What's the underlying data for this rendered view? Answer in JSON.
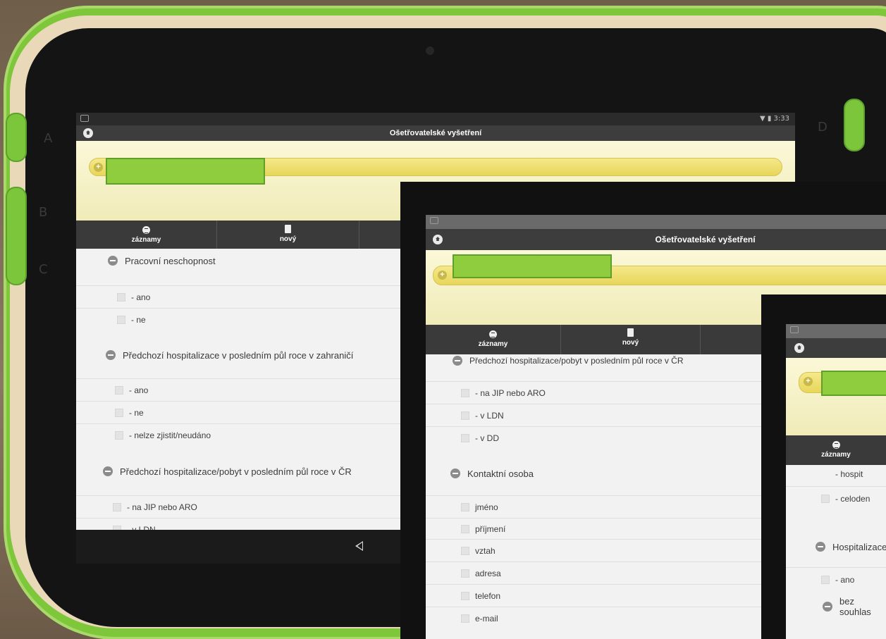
{
  "app": {
    "title": "Ošetřovatelské vyšetření",
    "status_time": "3:33"
  },
  "toolbar": {
    "records_label": "záznamy",
    "new_label": "nový"
  },
  "bezel": {
    "letters": [
      "A",
      "B",
      "C",
      "D"
    ]
  },
  "screen1": {
    "sections": [
      {
        "title": "Pracovní neschopnost",
        "options": [
          "- ano",
          "- ne"
        ]
      },
      {
        "title": "Předchozí hospitalizace v posledním půl roce v zahraničí",
        "options": [
          "- ano",
          "- ne",
          "- nelze zjistit/neudáno"
        ]
      },
      {
        "title": "Předchozí hospitalizace/pobyt v posledním půl roce v ČR",
        "options": [
          "- na JIP nebo ARO",
          "- v LDN"
        ]
      }
    ]
  },
  "screen2": {
    "sections": [
      {
        "title": "Předchozí hospitalizace/pobyt v posledním půl roce v ČR",
        "options": [
          "- na JIP nebo ARO",
          "- v LDN",
          "- v DD"
        ]
      },
      {
        "title": "Kontaktní osoba",
        "options": [
          "jméno",
          "příjmení",
          "vztah",
          "adresa",
          "telefon",
          "e-mail"
        ]
      }
    ]
  },
  "screen3": {
    "options_top": [
      "- hospit",
      "- celoden"
    ],
    "sections": [
      {
        "title": "Hospitalizace",
        "options": [
          "- ano"
        ]
      },
      {
        "title": "bez souhlas",
        "options": []
      }
    ]
  },
  "colors": {
    "tablet_green": "#7ec63a",
    "redaction_green": "#8fcc3e",
    "title_bar": "#3d3d3d",
    "banner_yellow": "#f0ebb8"
  }
}
